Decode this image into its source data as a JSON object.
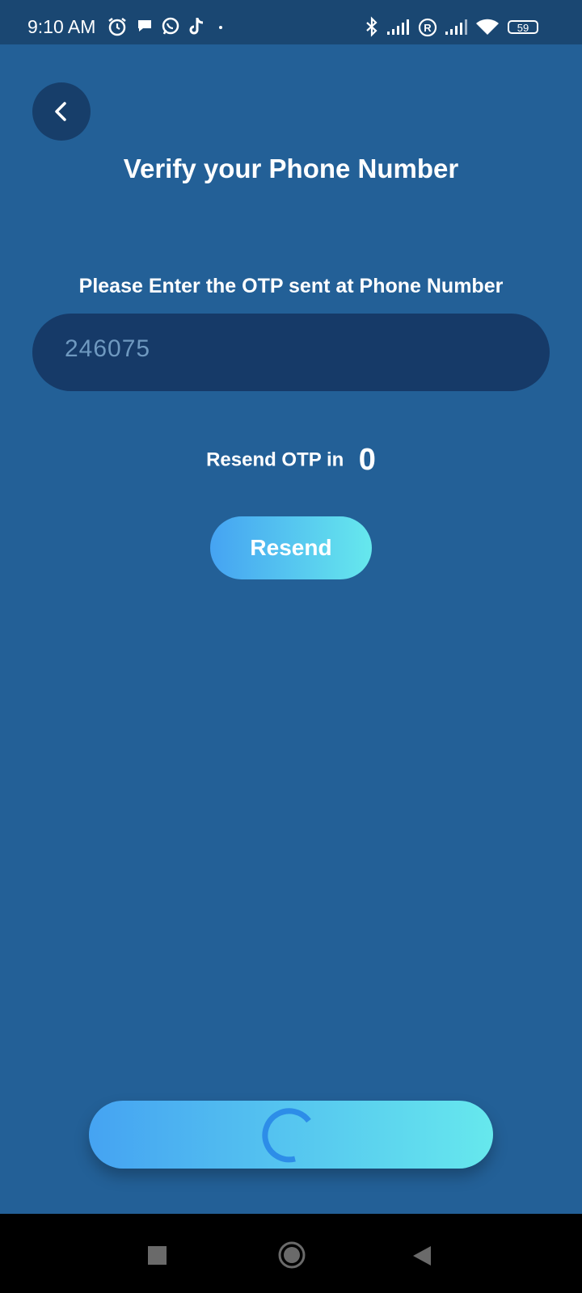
{
  "status_bar": {
    "time": "9:10 AM",
    "left_icons": [
      "alarm-icon",
      "chat-bubble-icon",
      "whatsapp-icon",
      "tiktok-icon",
      "dot-icon"
    ],
    "right_icons": [
      "bluetooth-icon",
      "signal-icon",
      "roaming-icon",
      "signal-icon",
      "wifi-icon",
      "battery-icon"
    ],
    "battery_level": "59"
  },
  "header": {
    "back_icon": "chevron-left-icon",
    "title": "Verify your Phone Number"
  },
  "otp": {
    "instruction": "Please Enter the OTP sent at Phone Number",
    "value": "246075"
  },
  "resend": {
    "label": "Resend OTP in",
    "countdown": "0",
    "button_label": "Resend"
  },
  "verify_button": {
    "state": "loading",
    "spinner_icon": "loading-spinner-icon"
  },
  "nav_bar": {
    "icons": [
      "recents-square-icon",
      "home-circle-icon",
      "back-triangle-icon"
    ]
  },
  "colors": {
    "background": "#236097",
    "status_bar": "#1a4772",
    "field_background": "#163a68",
    "gradient_start": "#45a3f2",
    "gradient_end": "#66e8ed",
    "spinner": "#2d8de8"
  }
}
